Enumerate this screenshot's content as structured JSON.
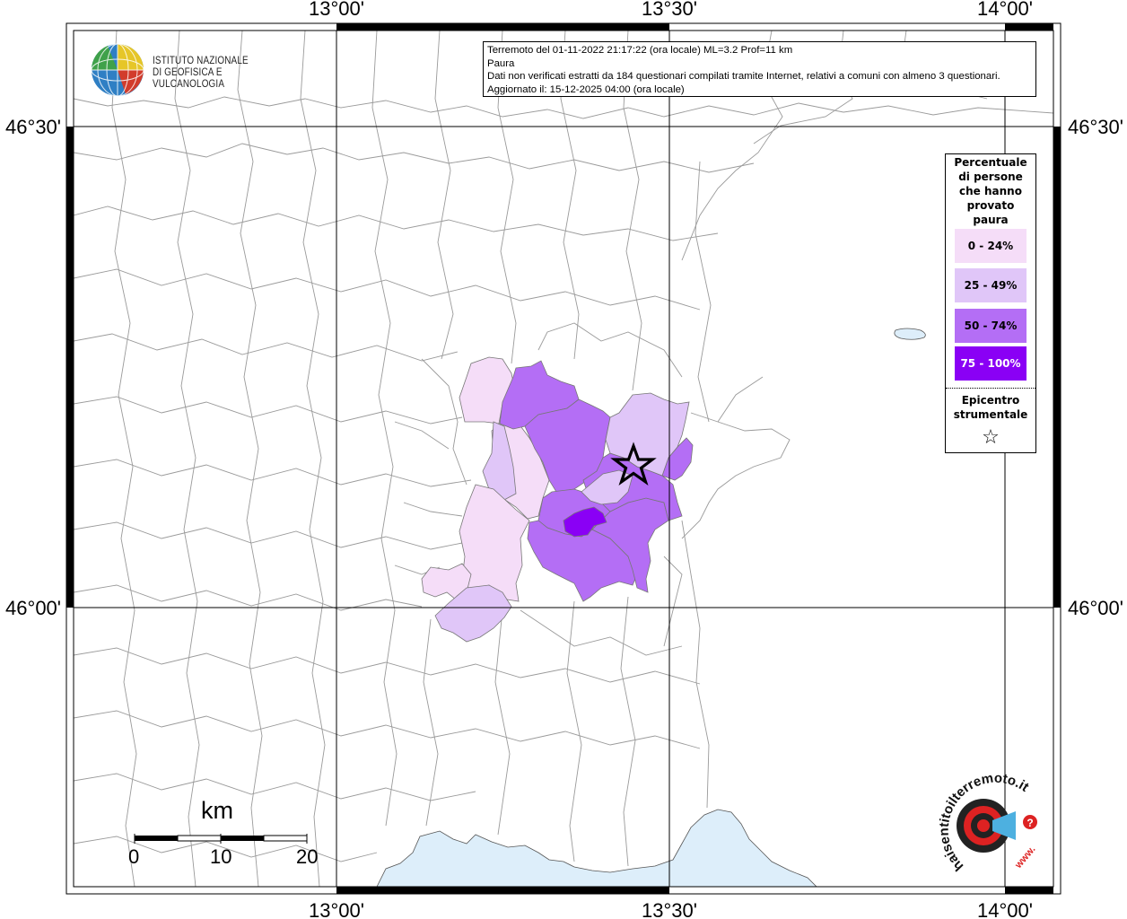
{
  "map": {
    "lon_ticks": [
      "13°00'",
      "13°30'",
      "14°00'"
    ],
    "lat_ticks": [
      "46°30'",
      "46°00'"
    ]
  },
  "logo": {
    "line1": "ISTITUTO NAZIONALE",
    "line2": "DI GEOFISICA E VULCANOLOGIA"
  },
  "info": {
    "line1": "Terremoto del 01-11-2022 21:17:22 (ora locale) ML=3.2 Prof=11 km",
    "line2": "Paura",
    "line3": "Dati non verificati estratti da 184 questionari compilati tramite Internet, relativi a comuni con almeno 3 questionari.",
    "line4": "Aggiornato il: 15-12-2025 04:00 (ora locale)"
  },
  "legend": {
    "title_lines": [
      "Percentuale",
      "di persone",
      "che hanno",
      "provato",
      "paura"
    ],
    "classes": [
      {
        "label": "0 - 24%",
        "color": "#f5ddf8"
      },
      {
        "label": "25 - 49%",
        "color": "#e0c6f8"
      },
      {
        "label": "50 - 74%",
        "color": "#b46ef5"
      },
      {
        "label": "75 - 100%",
        "color": "#8a00f5"
      }
    ],
    "epicenter_lines": [
      "Epicentro",
      "strumentale"
    ],
    "epicenter_symbol": "☆"
  },
  "scale": {
    "unit": "km",
    "labels": [
      "0",
      "10",
      "20"
    ]
  },
  "hst_logo": {
    "text": "haisentitoilterremoto.it",
    "www": "www.",
    "badge": "?"
  },
  "colors": {
    "sea": "#ddeefa",
    "border": "#a0a0a0",
    "frame": "#000000"
  }
}
